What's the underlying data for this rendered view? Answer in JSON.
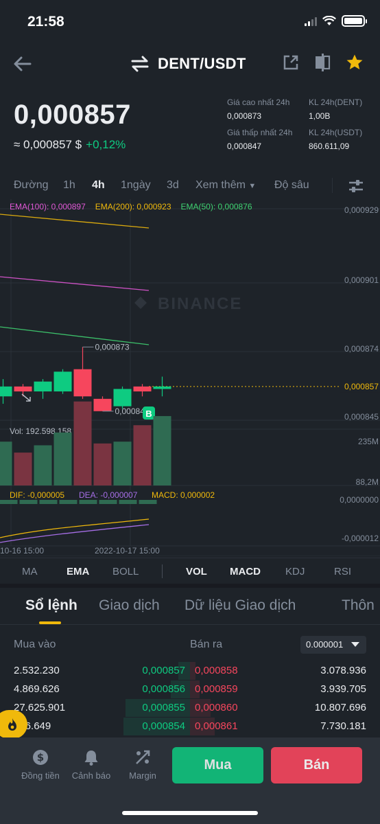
{
  "status": {
    "time": "21:58"
  },
  "header": {
    "pair": "DENT/USDT"
  },
  "price": {
    "last": "0,000857",
    "fiat": "≈ 0,000857 $",
    "change": "+0,12%"
  },
  "stats": {
    "high_label": "Giá cao nhất 24h",
    "high_value": "0,000873",
    "low_label": "Giá thấp nhất 24h",
    "low_value": "0,000847",
    "vol_base_label": "KL 24h(DENT)",
    "vol_base_value": "1,00B",
    "vol_quote_label": "KL 24h(USDT)",
    "vol_quote_value": "860.611,09"
  },
  "timeframes": [
    "Đường",
    "1h",
    "4h",
    "1ngày",
    "3d",
    "Xem thêm",
    "Độ sâu"
  ],
  "active_timeframe": "4h",
  "chart": {
    "ema_legend": [
      "EMA(100): 0,000897",
      "EMA(200): 0,000923",
      "EMA(50): 0,000876"
    ],
    "ema_colors": [
      "#e158d6",
      "#f0b90b",
      "#3fd271"
    ],
    "watermark": "BINANCE",
    "high_marker": "0,000873",
    "low_marker": "0,000847",
    "buy_marker": "B",
    "volume_label": "Vol: 192.598.158",
    "macd_legend": [
      "DIF: -0,000005",
      "DEA: -0,000007",
      "MACD: 0,000002"
    ],
    "macd_colors": [
      "#f0b90b",
      "#a66ee6",
      "#f0b90b"
    ],
    "x_labels": [
      "10-16 15:00",
      "2022-10-17 15:00"
    ]
  },
  "chart_data": {
    "type": "candlestick",
    "price_axis": [
      "0,000929",
      "0,000901",
      "0,000874",
      "0,000857",
      "0,000845"
    ],
    "volume_axis": [
      "235M",
      "88,2M"
    ],
    "macd_axis": [
      "0,0000000",
      "-0,000012"
    ],
    "candles": [
      {
        "open": 0.000853,
        "close": 0.000857,
        "high": 0.00086,
        "low": 0.00085
      },
      {
        "open": 0.000857,
        "close": 0.000855,
        "high": 0.000858,
        "low": 0.000853
      },
      {
        "open": 0.000855,
        "close": 0.000859,
        "high": 0.00086,
        "low": 0.000852
      },
      {
        "open": 0.000855,
        "close": 0.000863,
        "high": 0.000864,
        "low": 0.000854
      },
      {
        "open": 0.000864,
        "close": 0.000853,
        "high": 0.000873,
        "low": 0.000852
      },
      {
        "open": 0.000852,
        "close": 0.000847,
        "high": 0.000853,
        "low": 0.000847
      },
      {
        "open": 0.000849,
        "close": 0.000856,
        "high": 0.000857,
        "low": 0.000848
      },
      {
        "open": 0.000857,
        "close": 0.000855,
        "high": 0.000858,
        "low": 0.000853
      },
      {
        "open": 0.000856,
        "close": 0.000857,
        "high": 0.000861,
        "low": 0.000853
      }
    ],
    "volumes": [
      120,
      90,
      110,
      145,
      230,
      115,
      120,
      165,
      190
    ],
    "current_price": 0.000857
  },
  "indicators": [
    "MA",
    "EMA",
    "BOLL",
    "VOL",
    "MACD",
    "KDJ",
    "RSI"
  ],
  "active_indicators": [
    "EMA",
    "VOL",
    "MACD"
  ],
  "tabs": [
    "Sổ lệnh",
    "Giao dịch",
    "Dữ liệu Giao dịch",
    "Thôn"
  ],
  "orderbook": {
    "buy_label": "Mua vào",
    "sell_label": "Bán ra",
    "precision": "0.000001",
    "rows": [
      {
        "bid_qty": "2.532.230",
        "bid": "0,000857",
        "ask": "0,000858",
        "ask_qty": "3.078.936",
        "bid_depth": 0.06,
        "ask_depth": 0.03
      },
      {
        "bid_qty": "4.869.626",
        "bid": "0,000856",
        "ask": "0,000859",
        "ask_qty": "3.939.705",
        "bid_depth": 0.1,
        "ask_depth": 0.05
      },
      {
        "bid_qty": "27.625.901",
        "bid": "0,000855",
        "ask": "0,000860",
        "ask_qty": "10.807.696",
        "bid_depth": 0.34,
        "ask_depth": 0.11
      },
      {
        "bid_qty": "486.649",
        "bid": "0,000854",
        "ask": "0,000861",
        "ask_qty": "7.730.181",
        "bid_depth": 0.35,
        "ask_depth": 0.13
      }
    ]
  },
  "bottom": {
    "convert": "Đồng tiền",
    "alert": "Cảnh báo",
    "margin": "Margin",
    "buy": "Mua",
    "sell": "Bán"
  },
  "colors": {
    "up": "#0ecb81",
    "down": "#f6465d",
    "accent": "#f0b90b",
    "bg": "#1e2329"
  }
}
